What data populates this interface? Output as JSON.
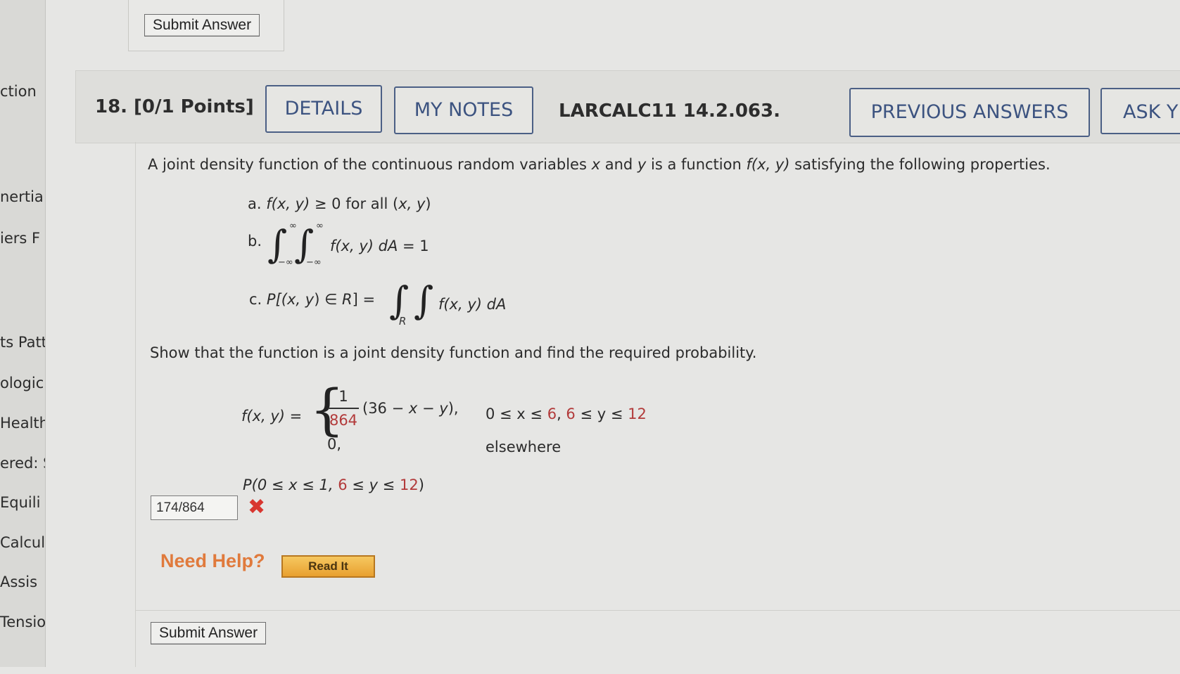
{
  "sidebar": {
    "items": [
      "ction",
      "nertia",
      "iers F",
      "ts Patt",
      "ologic",
      "Health",
      "ered: S",
      "Equili",
      "Calcula",
      "Assis",
      "Tensio"
    ]
  },
  "top": {
    "submit_label": "Submit Answer"
  },
  "question": {
    "number": "18.",
    "points": "[0/1 Points]",
    "details_label": "DETAILS",
    "notes_label": "MY NOTES",
    "code": "LARCALC11 14.2.063.",
    "prev_answers_label": "PREVIOUS ANSWERS",
    "ask_label": "ASK Y"
  },
  "body": {
    "intro_1": "A joint density function of the continuous random variables ",
    "intro_x": "x",
    "intro_2": " and ",
    "intro_y": "y",
    "intro_3": " is a function ",
    "intro_f": "f(x, y)",
    "intro_4": " satisfying the following properties.",
    "prop_a_label": "a.",
    "prop_a_f": "f(x, y)",
    "prop_a_rest": " ≥ 0 for all (",
    "prop_a_xy": "x, y",
    "prop_a_end": ")",
    "prop_b_label": "b.",
    "prop_b_upper": "∞",
    "prop_b_lower": "−∞",
    "prop_b_expr": "f(x, y) dA",
    "prop_b_eq": " = 1",
    "prop_c_label": "c.",
    "prop_c_lhs_1": "P[(",
    "prop_c_lhs_xy": "x, y",
    "prop_c_lhs_2": ") ∈ ",
    "prop_c_lhs_R": "R",
    "prop_c_lhs_3": "] =",
    "prop_c_region": "R",
    "prop_c_expr": "f(x, y) dA",
    "instruction": "Show that the function is a joint density function and find the required probability.",
    "f_lhs": "f(x, y) =",
    "frac_num": "1",
    "frac_den": "864",
    "case1_expr_1": "(36 − ",
    "case1_expr_x": "x",
    "case1_expr_2": " − ",
    "case1_expr_y": "y",
    "case1_expr_3": "),",
    "case1_cond_1": "0 ≤ x ≤ ",
    "case1_cond_6a": "6",
    "case1_cond_2": ", ",
    "case1_cond_6b": "6",
    "case1_cond_3": " ≤ y ≤ ",
    "case1_cond_12": "12",
    "case2_expr": "0,",
    "case2_cond": "elsewhere",
    "prob_1": "P(0 ≤ x ≤ 1, ",
    "prob_6": "6",
    "prob_2": " ≤ y ≤ ",
    "prob_12": "12",
    "prob_3": ")"
  },
  "answer": {
    "value": "174/864",
    "status_icon": "x-mark-icon"
  },
  "help": {
    "label": "Need Help?",
    "read_it_label": "Read It"
  },
  "bottom": {
    "submit_label": "Submit Answer"
  },
  "colors": {
    "button_text": "#3c5380",
    "highlight": "#b23a3a",
    "help": "#e07a3c",
    "wrong": "#d8362f"
  }
}
